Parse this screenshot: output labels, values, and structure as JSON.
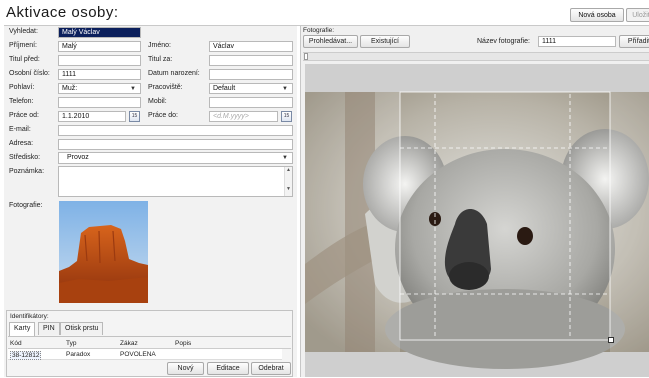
{
  "page": {
    "title": "Aktivace osoby:"
  },
  "toolbar": {
    "new_person": "Nová osoba",
    "save": "Uložit"
  },
  "form": {
    "search_label": "Vyhledat:",
    "search_value": "Malý Václav",
    "surname_label": "Příjmení:",
    "surname_value": "Malý",
    "firstname_label": "Jméno:",
    "firstname_value": "Václav",
    "title_before_label": "Titul před:",
    "title_before_value": "",
    "title_after_label": "Titul za:",
    "title_after_value": "",
    "personal_no_label": "Osobní číslo:",
    "personal_no_value": "1111",
    "birthdate_label": "Datum narození:",
    "birthdate_value": "",
    "gender_label": "Pohlaví:",
    "gender_value": "Muž:",
    "workplace_label": "Pracoviště:",
    "workplace_value": "Default",
    "phone_label": "Telefon:",
    "phone_value": "",
    "mobile_label": "Mobil:",
    "mobile_value": "",
    "work_from_label": "Práce od:",
    "work_from_value": "1.1.2010",
    "work_to_label": "Práce do:",
    "work_to_placeholder": "<d.M.yyyy>",
    "email_label": "E-mail:",
    "email_value": "",
    "address_label": "Adresa:",
    "address_value": "",
    "center_label": "Středisko:",
    "center_value": "Provoz",
    "note_label": "Poznámka:",
    "note_value": "",
    "photo_label": "Fotografie:",
    "calendar_glyph": "15"
  },
  "identifiers": {
    "title": "Identifikátory:",
    "tabs": [
      "Karty",
      "PIN",
      "Otisk prstu"
    ],
    "columns": [
      "Kód",
      "Typ",
      "Zákaz",
      "Popis"
    ],
    "rows": [
      {
        "code": "38-12812",
        "type": "Paradox",
        "ban": "POVOLENA",
        "desc": ""
      }
    ],
    "buttons": {
      "new": "Nový",
      "edit": "Editace",
      "delete": "Odebrat"
    }
  },
  "photo_panel": {
    "title": "Fotografie:",
    "browse": "Prohledávat...",
    "existing": "Existující",
    "name_label": "Název fotografie:",
    "name_value": "1111",
    "assign": "Přiřadit"
  },
  "colors": {
    "selection": "#0b1f5c",
    "panel": "#f2f2f2"
  }
}
